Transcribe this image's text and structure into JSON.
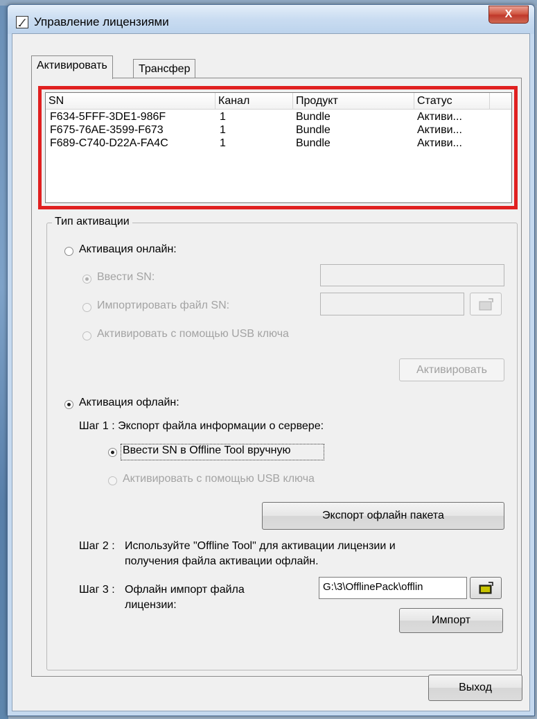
{
  "window": {
    "title": "Управление лицензиями",
    "close_glyph": "X"
  },
  "tabs": [
    {
      "label": "Активировать",
      "active": true
    },
    {
      "label": "Трансфер",
      "active": false
    }
  ],
  "license_list": {
    "columns": [
      "SN",
      "Канал",
      "Продукт",
      "Статус"
    ],
    "rows": [
      {
        "sn": "F634-5FFF-3DE1-986F",
        "channel": "1",
        "product": "Bundle",
        "status": "Активи..."
      },
      {
        "sn": "F675-76AE-3599-F673",
        "channel": "1",
        "product": "Bundle",
        "status": "Активи..."
      },
      {
        "sn": "F689-C740-D22A-FA4C",
        "channel": "1",
        "product": "Bundle",
        "status": "Активи..."
      }
    ]
  },
  "activation": {
    "group_label": "Тип активации",
    "online": {
      "label": "Активация онлайн:",
      "selected": false,
      "enter_sn_label": "Ввести SN:",
      "import_sn_label": "Импортировать файл SN:",
      "usb_label": "Активировать с помощью USB ключа",
      "activate_button": "Активировать"
    },
    "offline": {
      "label": "Активация офлайн:",
      "selected": true,
      "step1_label": "Шаг 1 :  Экспорт файла информации о сервере:",
      "manual_sn_label": "Ввести SN в Offline Tool вручную",
      "usb_label": "Активировать с помощью USB ключа",
      "export_button": "Экспорт офлайн пакета",
      "step2_label": "Шаг 2 :",
      "step2_text_line1": "Используйте \"Offline Tool\" для активации лицензии и",
      "step2_text_line2": "получения файла активации офлайн.",
      "step3_label": "Шаг 3 :",
      "step3_text_line1": "Офлайн импорт файла",
      "step3_text_line2": "лицензии:",
      "import_path": "G:\\3\\OfflinePack\\offlin",
      "import_button": "Импорт"
    }
  },
  "exit_button": "Выход",
  "colors": {
    "highlight_border": "#e02020"
  }
}
